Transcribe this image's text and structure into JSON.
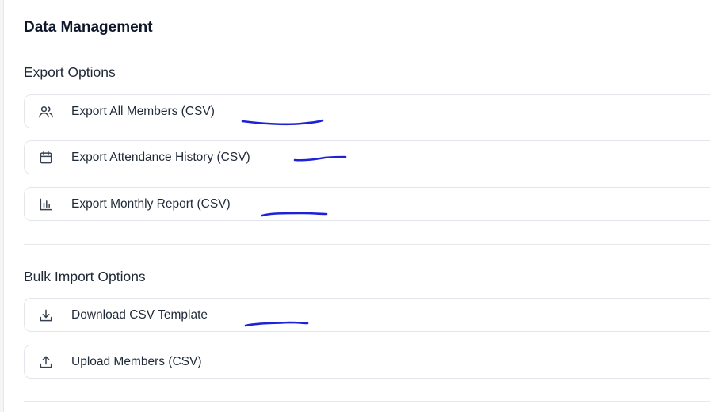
{
  "page": {
    "title": "Data Management"
  },
  "export_section": {
    "heading": "Export Options",
    "items": [
      {
        "label": "Export All Members (CSV)",
        "icon": "users-icon"
      },
      {
        "label": "Export Attendance History (CSV)",
        "icon": "calendar-icon"
      },
      {
        "label": "Export Monthly Report (CSV)",
        "icon": "bar-chart-icon"
      }
    ]
  },
  "import_section": {
    "heading": "Bulk Import Options",
    "items": [
      {
        "label": "Download CSV Template",
        "icon": "download-icon"
      },
      {
        "label": "Upload Members (CSV)",
        "icon": "upload-icon"
      }
    ]
  },
  "colors": {
    "annotation_ink": "#1d22d6",
    "border": "#e3e6ea",
    "text": "#1f2937"
  }
}
